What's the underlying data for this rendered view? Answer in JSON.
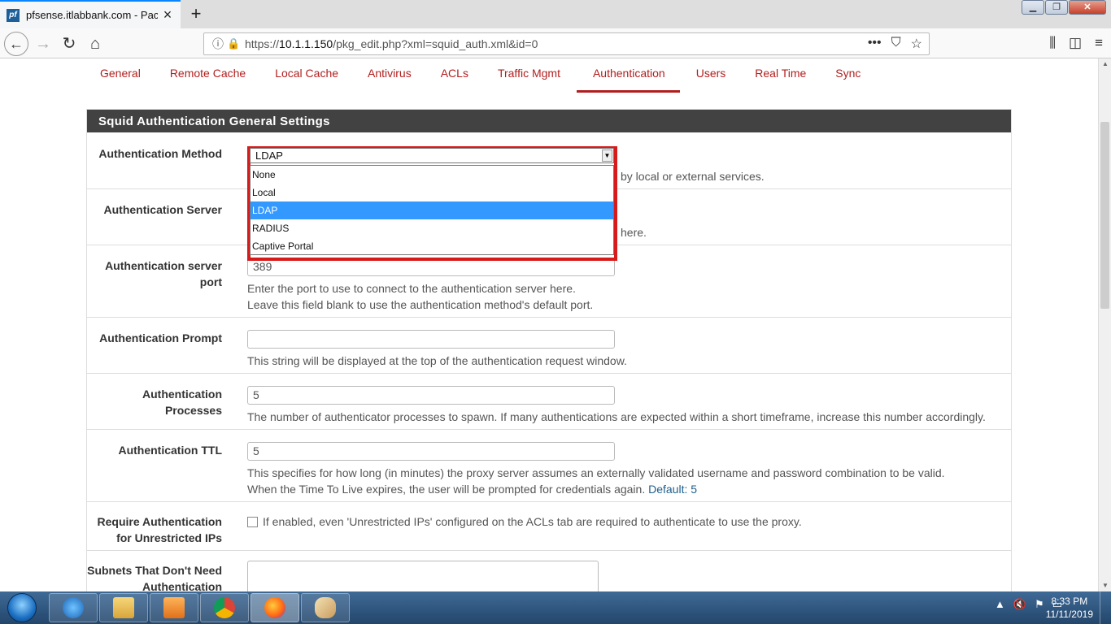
{
  "browser": {
    "tab_title": "pfsense.itlabbank.com - Packa",
    "favicon_text": "pf",
    "url_prefix": "https://",
    "url_host": "10.1.1.150",
    "url_path": "/pkg_edit.php?xml=squid_auth.xml&id=0"
  },
  "subnav": {
    "items": [
      "General",
      "Remote Cache",
      "Local Cache",
      "Antivirus",
      "ACLs",
      "Traffic Mgmt",
      "Authentication",
      "Users",
      "Real Time",
      "Sync"
    ],
    "active": "Authentication"
  },
  "panel": {
    "title": "Squid Authentication General Settings"
  },
  "form": {
    "auth_method": {
      "label": "Authentication Method",
      "value": "LDAP",
      "help_tail": "by local or external services.",
      "options": [
        "None",
        "Local",
        "LDAP",
        "RADIUS",
        "Captive Portal"
      ]
    },
    "auth_server": {
      "label": "Authentication Server",
      "help_tail": "here."
    },
    "auth_port": {
      "label_line1": "Authentication server",
      "label_line2": "port",
      "value": "389",
      "help1": "Enter the port to use to connect to the authentication server here.",
      "help2": "Leave this field blank to use the authentication method's default port."
    },
    "auth_prompt": {
      "label": "Authentication Prompt",
      "value": "",
      "help": "This string will be displayed at the top of the authentication request window."
    },
    "auth_processes": {
      "label": "Authentication Processes",
      "value": "5",
      "help": "The number of authenticator processes to spawn. If many authentications are expected within a short timeframe, increase this number accordingly."
    },
    "auth_ttl": {
      "label": "Authentication TTL",
      "value": "5",
      "help1": "This specifies for how long (in minutes) the proxy server assumes an externally validated username and password combination to be valid.",
      "help2": "When the Time To Live expires, the user will be prompted for credentials again.",
      "default": "Default: 5"
    },
    "require_auth": {
      "label_line1": "Require Authentication",
      "label_line2": "for Unrestricted IPs",
      "help": "If enabled, even 'Unrestricted IPs' configured on the ACLs tab are required to authenticate to use the proxy."
    },
    "subnets": {
      "label_line1": "Subnets That Don't Need",
      "label_line2": "Authentication"
    }
  },
  "taskbar": {
    "time": "8:33 PM",
    "date": "11/11/2019"
  },
  "colors": {
    "accent_red": "#b21e1e",
    "panel_header": "#424242",
    "highlight": "#d71a1a",
    "selection": "#3399ff"
  }
}
